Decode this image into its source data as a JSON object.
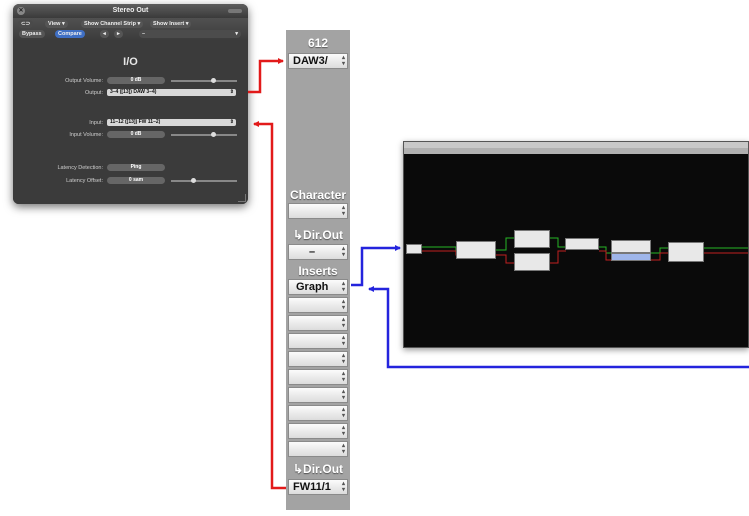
{
  "io_window": {
    "title": "Stereo Out",
    "toolbar": {
      "view": "View",
      "show_channel_strip": "Show Channel Strip",
      "show_insert": "Show Insert",
      "bypass": "Bypass",
      "compare": "Compare",
      "prev": "◂",
      "next": "▸",
      "preset": "–"
    },
    "heading": "I/O",
    "output_volume_label": "Output Volume:",
    "output_volume_value": "0 dB",
    "output_label": "Output:",
    "output_value": "3–4  ([13]) DAW 3–4)",
    "input_label": "Input:",
    "input_value": "11–12  ([13]) FW 11–2)",
    "input_volume_label": "Input Volume:",
    "input_volume_value": "0 dB",
    "latency_detection_label": "Latency Detection:",
    "ping_label": "Ping",
    "latency_offset_label": "Latency Offset:",
    "latency_offset_value": "0 sam"
  },
  "channel_strip": {
    "name": "612",
    "top_slot": "DAW3/",
    "character_label": "Character",
    "dir_out_label": "↳Dir.Out",
    "dir_out_value": "–",
    "inserts_label": "Inserts",
    "insert_graph": "Graph",
    "bottom_dir_out_label": "↳Dir.Out",
    "bottom_slot": "FW11/1"
  },
  "colors": {
    "red_arrow": "#e21a1a",
    "blue_arrow": "#2424dd",
    "strip_bg": "#a3a3a3"
  }
}
